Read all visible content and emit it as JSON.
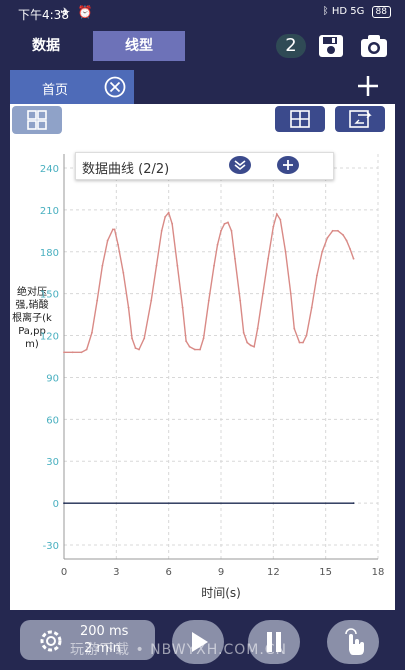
{
  "status": {
    "time": "下午4:38",
    "battery": "88",
    "signal1": "HD",
    "signal2": "5G"
  },
  "header": {
    "tabs": [
      {
        "label": "数据"
      },
      {
        "label": "线型"
      }
    ],
    "badge": "2"
  },
  "page": {
    "tab_label": "首页"
  },
  "chart_header": {
    "dropdown_label": "数据曲线 (2/2)"
  },
  "chart_data": {
    "type": "line",
    "ylabel": "绝对压强,硝酸根离子(kPa,ppm)",
    "xlabel": "时间(s)",
    "xlim": [
      0,
      18
    ],
    "ylim": [
      -40,
      250
    ],
    "xticks": [
      "0",
      "3",
      "6",
      "9",
      "12",
      "15",
      "18"
    ],
    "yticks": [
      "-30",
      "0",
      "30",
      "60",
      "90",
      "120",
      "150",
      "180",
      "210",
      "240"
    ],
    "grid": true,
    "series": [
      {
        "color": "#d98a86",
        "x": [
          0,
          0.5,
          1.0,
          1.3,
          1.6,
          1.9,
          2.2,
          2.5,
          2.8,
          2.9,
          3.1,
          3.4,
          3.7,
          3.9,
          4.1,
          4.3,
          4.6,
          5.0,
          5.3,
          5.6,
          5.8,
          6.0,
          6.2,
          6.5,
          6.8,
          7.0,
          7.2,
          7.5,
          7.8,
          8.0,
          8.3,
          8.6,
          8.8,
          9.0,
          9.2,
          9.4,
          9.6,
          9.8,
          10.1,
          10.3,
          10.5,
          10.7,
          10.9,
          11.1,
          11.4,
          11.7,
          12.0,
          12.2,
          12.4,
          12.7,
          13.0,
          13.2,
          13.5,
          13.7,
          13.9,
          14.2,
          14.5,
          14.8,
          15.1,
          15.4,
          15.7,
          16.0,
          16.2,
          16.4,
          16.6
        ],
        "y": [
          108,
          108,
          108,
          110,
          122,
          145,
          170,
          188,
          196,
          196,
          185,
          165,
          140,
          118,
          111,
          110,
          118,
          145,
          170,
          195,
          205,
          208,
          200,
          170,
          140,
          116,
          112,
          110,
          110,
          118,
          145,
          170,
          185,
          195,
          200,
          201,
          195,
          175,
          145,
          122,
          115,
          113,
          112,
          125,
          150,
          175,
          198,
          207,
          203,
          180,
          150,
          125,
          115,
          115,
          120,
          140,
          163,
          180,
          190,
          195,
          195,
          192,
          188,
          182,
          175
        ]
      },
      {
        "color": "#1c2a50",
        "x": [
          0,
          16.6
        ],
        "y": [
          0,
          0
        ]
      }
    ]
  },
  "controls": {
    "interval": "200 ms",
    "duration": "2 min"
  },
  "watermark": "玩游下载 • NBWYXH.COM.CN"
}
